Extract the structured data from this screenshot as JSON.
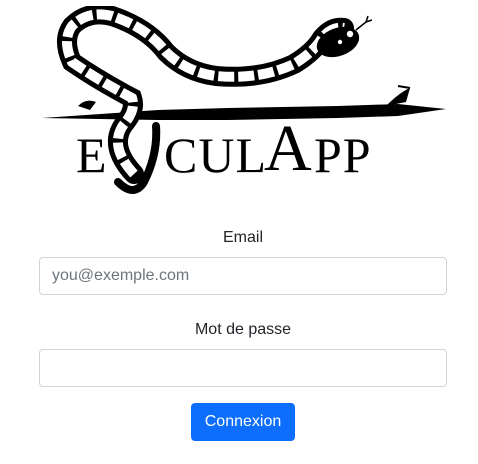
{
  "logo": {
    "text_parts": {
      "e": "E",
      "cul": "CUL",
      "a": "A",
      "pp": "PP"
    }
  },
  "form": {
    "email": {
      "label": "Email",
      "placeholder": "you@exemple.com",
      "value": ""
    },
    "password": {
      "label": "Mot de passe",
      "placeholder": "",
      "value": ""
    },
    "submit_label": "Connexion"
  },
  "colors": {
    "button_bg": "#0d6efd",
    "button_text": "#ffffff",
    "input_border": "#ced4da",
    "logo": "#000000"
  }
}
